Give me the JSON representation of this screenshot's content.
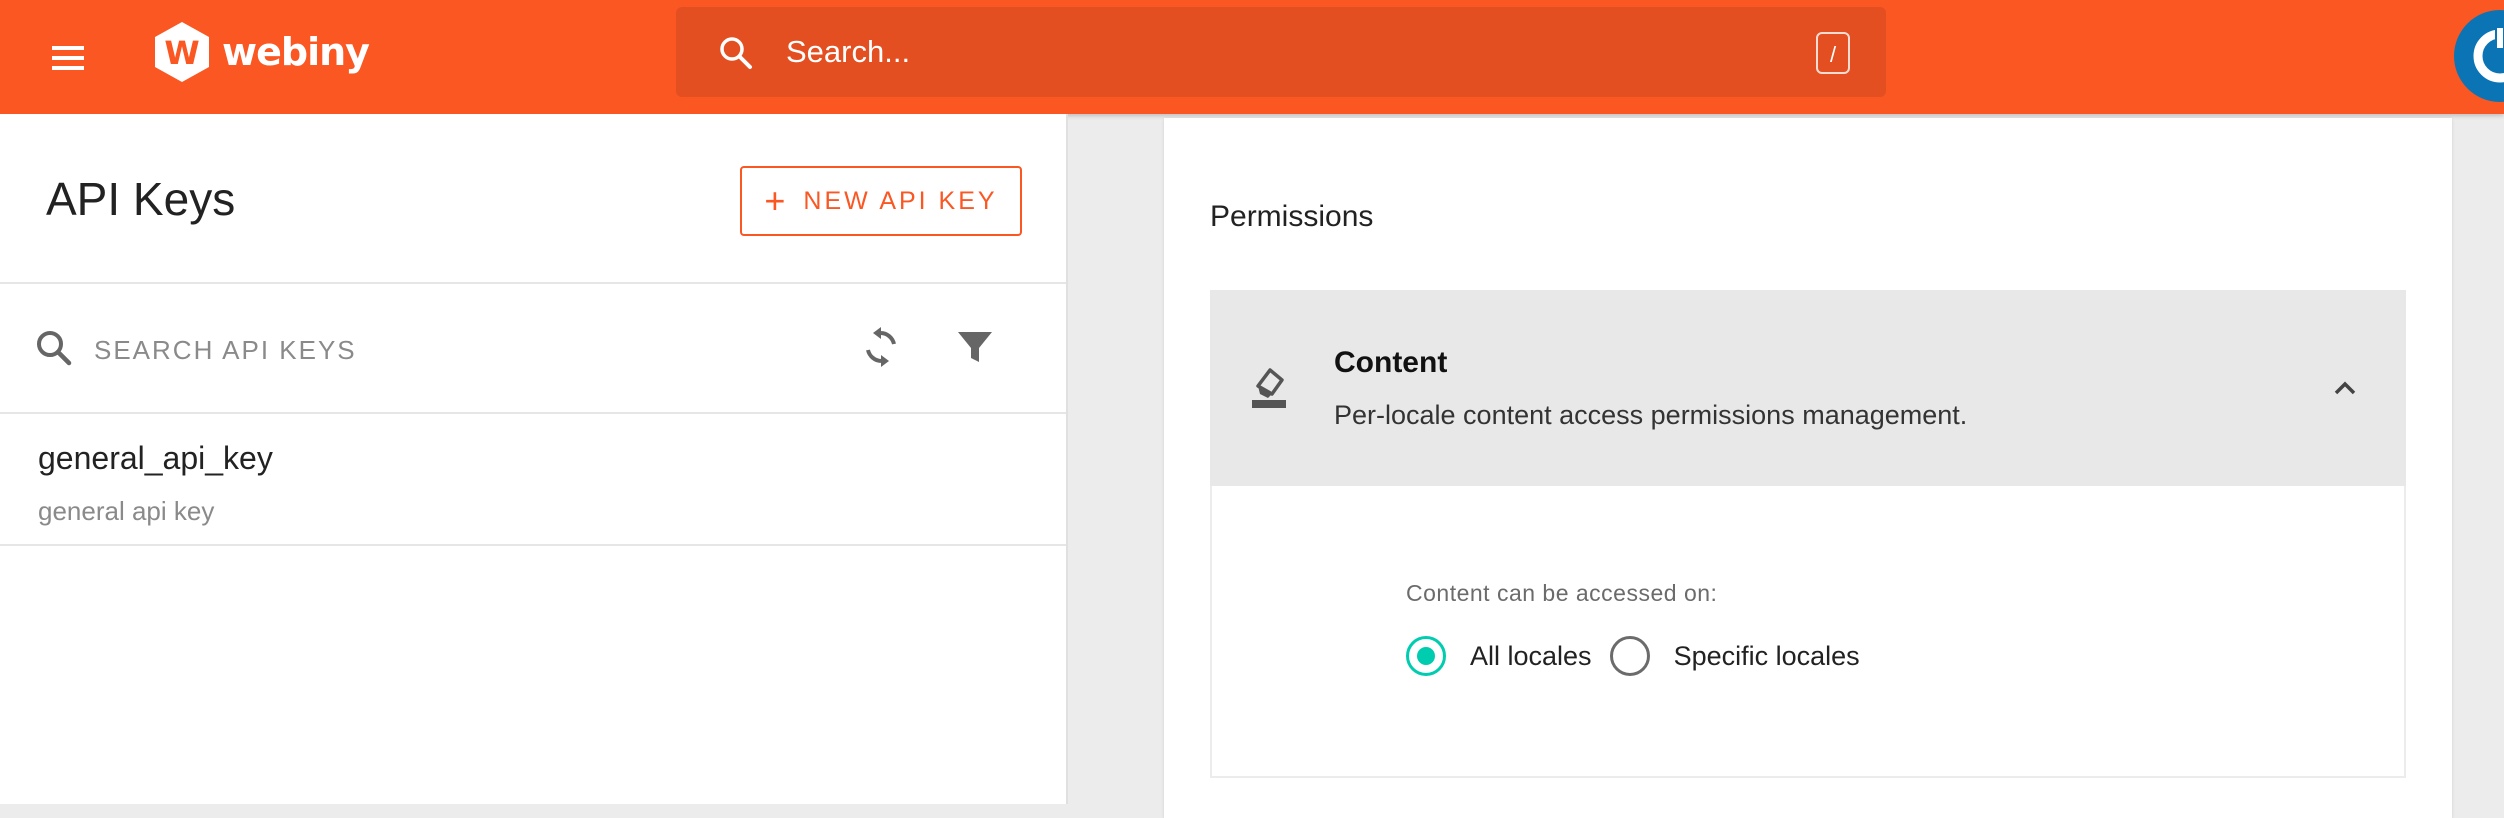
{
  "header": {
    "brand": "webiny",
    "search_placeholder": "Search...",
    "search_shortcut": "/"
  },
  "api_keys": {
    "title": "API Keys",
    "new_button_label": "NEW API KEY",
    "search_placeholder": "SEARCH API KEYS",
    "items": [
      {
        "name": "general_api_key",
        "description": "general api key"
      }
    ]
  },
  "permissions": {
    "title": "Permissions",
    "content": {
      "title": "Content",
      "description": "Per-locale content access permissions management.",
      "access_label": "Content can be accessed on:",
      "options": [
        {
          "label": "All locales",
          "selected": true
        },
        {
          "label": "Specific locales",
          "selected": false
        }
      ]
    }
  },
  "colors": {
    "brand": "#fa5723",
    "search_bg": "#e34f20",
    "radio_accent": "#00ccb0",
    "avatar": "#0a74b5"
  },
  "icons": [
    "menu-icon",
    "webiny-logo-icon",
    "search-icon",
    "user-avatar-icon",
    "plus-icon",
    "refresh-icon",
    "filter-icon",
    "content-eraser-icon",
    "chevron-up-icon"
  ]
}
